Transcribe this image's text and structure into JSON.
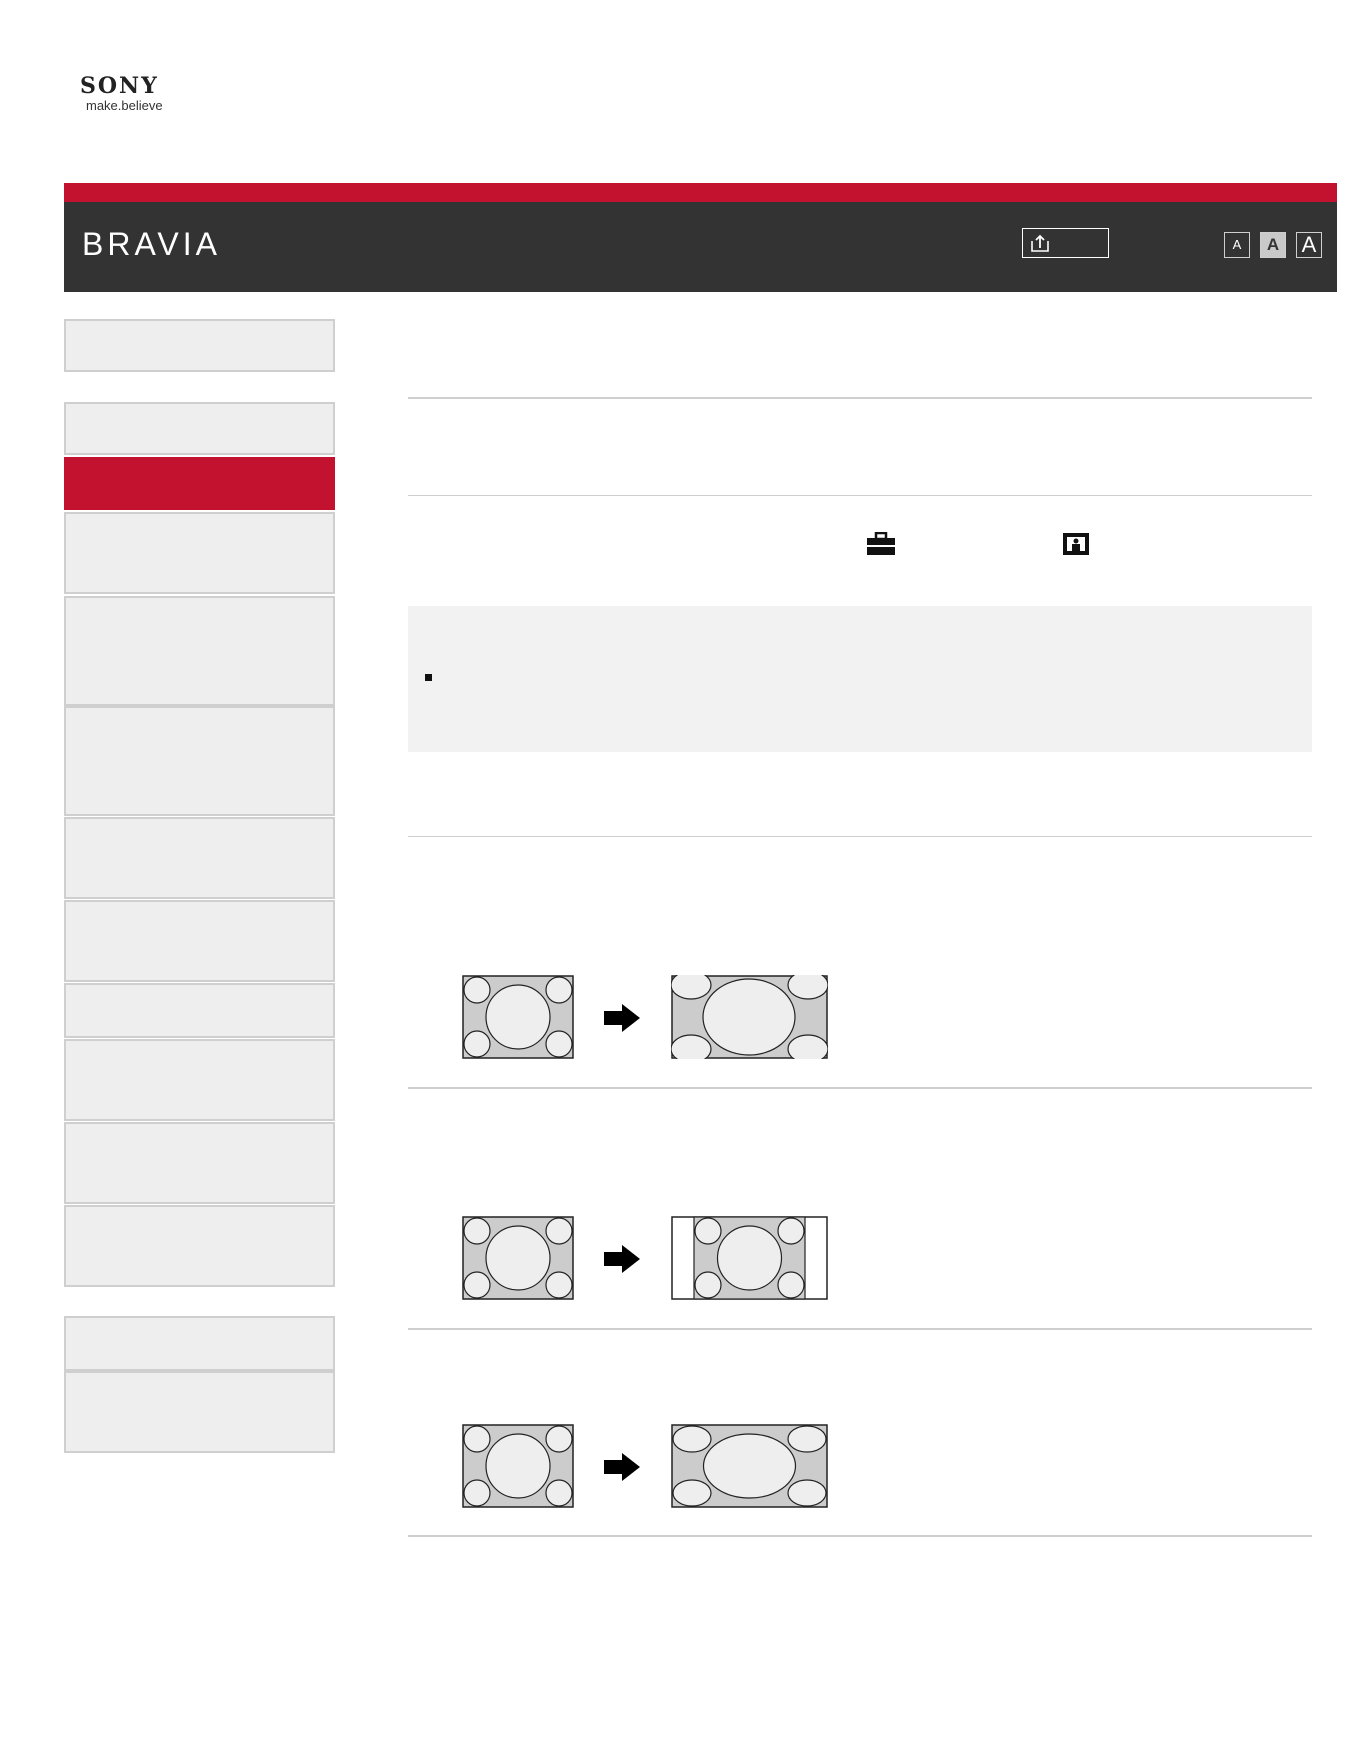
{
  "brand": {
    "logo_name": "SONY",
    "logo_tagline": "make.believe",
    "product": "BRAVIA"
  },
  "toolbar": {
    "font_small": "A",
    "font_medium": "A",
    "font_large": "A",
    "share_icon": "share-icon"
  },
  "colors": {
    "accent_red": "#c3122f",
    "header_dark": "#333333",
    "sidebar_bg": "#eeeeee",
    "note_bg": "#f2f2f2"
  },
  "sidebar": {
    "active_index": 1
  },
  "content": {
    "inline_icons": [
      "toolbox-icon",
      "picture-icon"
    ]
  },
  "illustrations": [
    {
      "from": "4:3 source",
      "to": "wide zoom"
    },
    {
      "from": "4:3 source",
      "to": "4:3 pillarbox"
    },
    {
      "from": "4:3 source",
      "to": "full stretch"
    }
  ]
}
